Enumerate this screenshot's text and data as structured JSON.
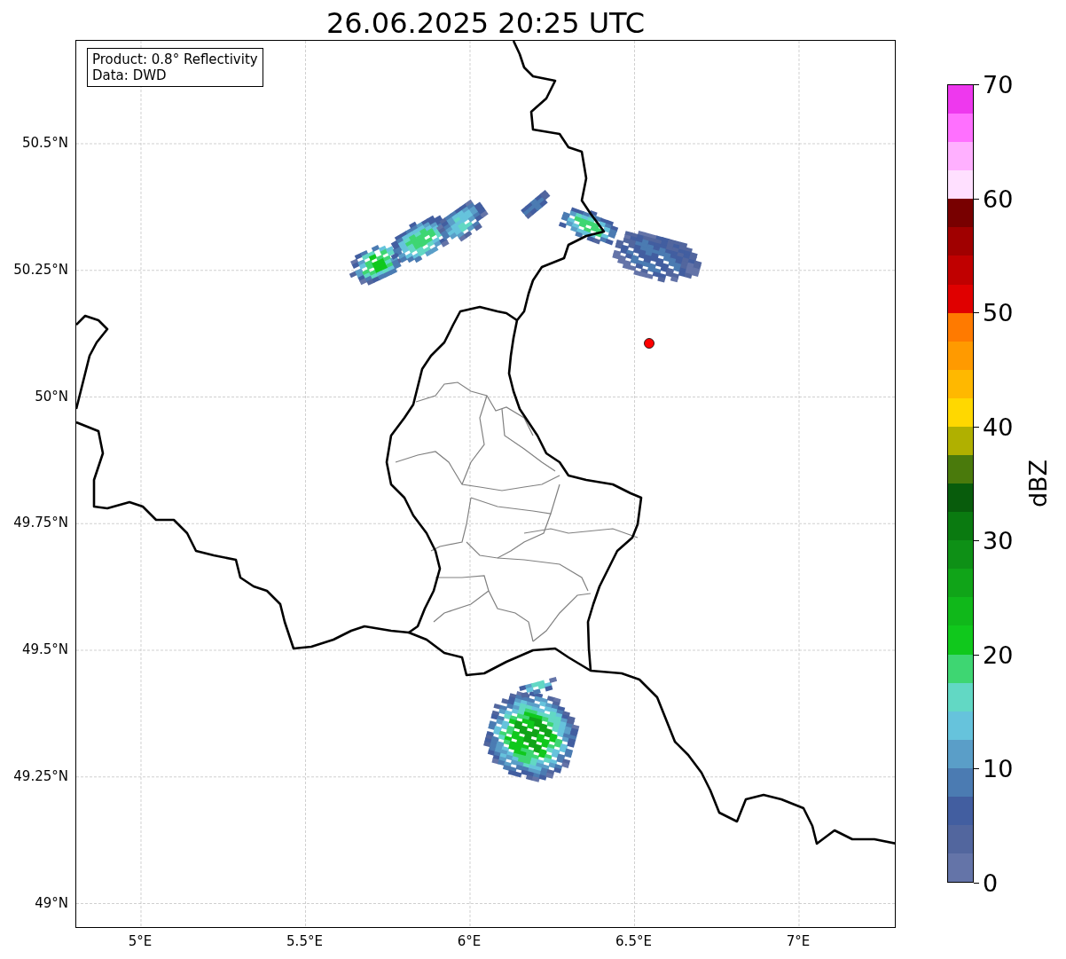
{
  "title": "26.06.2025 20:25 UTC",
  "info_box": {
    "product": "Product: 0.8° Reflectivity",
    "source": "Data: DWD"
  },
  "lat_ticks": [
    "50.5°N",
    "50.25°N",
    "50°N",
    "49.75°N",
    "49.5°N",
    "49.25°N",
    "49°N"
  ],
  "lon_ticks": [
    "5°E",
    "5.5°E",
    "6°E",
    "6.5°E",
    "7°E"
  ],
  "colorbar": {
    "label": "dBZ",
    "ticks": [
      "70",
      "60",
      "50",
      "40",
      "30",
      "20",
      "10",
      "0"
    ],
    "bands": [
      {
        "color": "#ee38ee"
      },
      {
        "color": "#ff70ff"
      },
      {
        "color": "#ffb0ff"
      },
      {
        "color": "#ffe0ff"
      },
      {
        "color": "#780000"
      },
      {
        "color": "#a00000"
      },
      {
        "color": "#c00000"
      },
      {
        "color": "#e00000"
      },
      {
        "color": "#ff7a00"
      },
      {
        "color": "#ff9a00"
      },
      {
        "color": "#ffb800"
      },
      {
        "color": "#ffd800"
      },
      {
        "color": "#b0b000"
      },
      {
        "color": "#4a7a0c"
      },
      {
        "color": "#085c0c"
      },
      {
        "color": "#0a7a10"
      },
      {
        "color": "#0e9016"
      },
      {
        "color": "#10a418"
      },
      {
        "color": "#10b81a"
      },
      {
        "color": "#10c81c"
      },
      {
        "color": "#3ed672"
      },
      {
        "color": "#62d8c4"
      },
      {
        "color": "#66c3dc"
      },
      {
        "color": "#5a9ec8"
      },
      {
        "color": "#4b7bb2"
      },
      {
        "color": "#425ea0"
      },
      {
        "color": "#52669e"
      },
      {
        "color": "#6474a8"
      }
    ]
  }
}
